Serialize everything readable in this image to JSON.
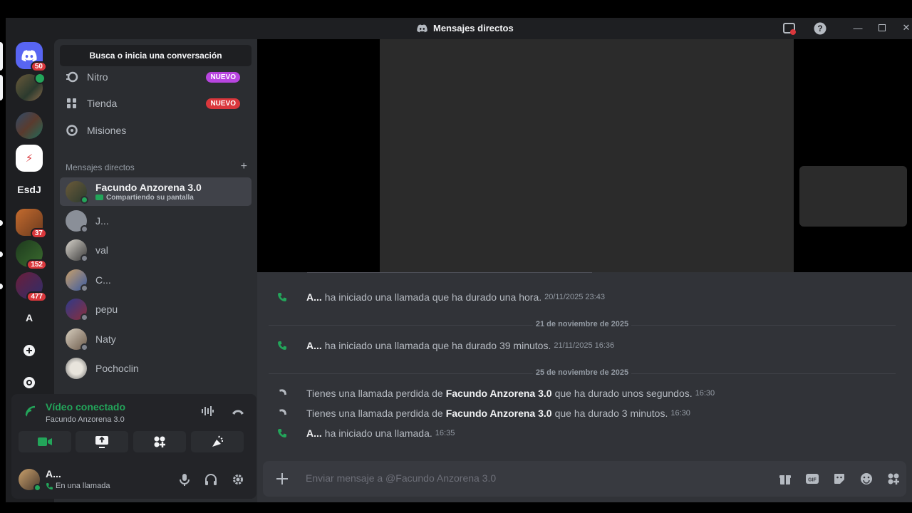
{
  "window": {
    "title": "Mensajes directos"
  },
  "rail": {
    "servers": [
      {
        "label": "",
        "badge": "50"
      },
      {
        "label": "",
        "badge": ""
      },
      {
        "label": "",
        "badge": ""
      },
      {
        "label": "",
        "badge": ""
      },
      {
        "label": "EsdJ",
        "badge": ""
      },
      {
        "label": "",
        "badge": "37"
      },
      {
        "label": "",
        "badge": "152"
      },
      {
        "label": "",
        "badge": "477"
      },
      {
        "label": "A",
        "badge": ""
      }
    ]
  },
  "sidebar": {
    "search_label": "Busca o inicia una conversación",
    "nav": [
      {
        "label": "Nitro",
        "badge": "NUEVO",
        "badge_color": "#b845e0"
      },
      {
        "label": "Tienda",
        "badge": "NUEVO",
        "badge_color": "#da373c"
      },
      {
        "label": "Misiones",
        "badge": "",
        "badge_color": ""
      }
    ],
    "dm_header": "Mensajes directos",
    "dms": [
      {
        "name": "Facundo Anzorena 3.0",
        "sub": "Compartiendo su pantalla"
      },
      {
        "name": "J..."
      },
      {
        "name": "val"
      },
      {
        "name": "C..."
      },
      {
        "name": "pepu"
      },
      {
        "name": "Naty"
      },
      {
        "name": "Pochoclin"
      }
    ]
  },
  "voice": {
    "status": "Vídeo conectado",
    "channel": "Facundo Anzorena 3.0"
  },
  "user": {
    "name": "A...",
    "status": "En una llamada"
  },
  "chat": {
    "messages": [
      {
        "type": "call",
        "author": "A...",
        "text": "ha iniciado una llamada que ha durado una hora.",
        "time": "20/11/2025 23:43"
      },
      {
        "type": "divider",
        "text": "21 de noviembre de 2025"
      },
      {
        "type": "call",
        "author": "A...",
        "text": "ha iniciado una llamada que ha durado 39 minutos.",
        "time": "21/11/2025 16:36"
      },
      {
        "type": "divider",
        "text": "25 de noviembre de 2025"
      },
      {
        "type": "missed",
        "pre": "Tienes una llamada perdida de",
        "author": "Facundo Anzorena 3.0",
        "text": "que ha durado unos segundos.",
        "time": "16:30"
      },
      {
        "type": "missed",
        "pre": "Tienes una llamada perdida de",
        "author": "Facundo Anzorena 3.0",
        "text": "que ha durado 3 minutos.",
        "time": "16:30"
      },
      {
        "type": "call",
        "author": "A...",
        "text": "ha iniciado una llamada.",
        "time": "16:35"
      }
    ],
    "composer_placeholder": "Enviar mensaje a @Facundo Anzorena 3.0"
  },
  "colors": {
    "green": "#23a55a",
    "red": "#da373c",
    "blurple": "#5865f2"
  }
}
